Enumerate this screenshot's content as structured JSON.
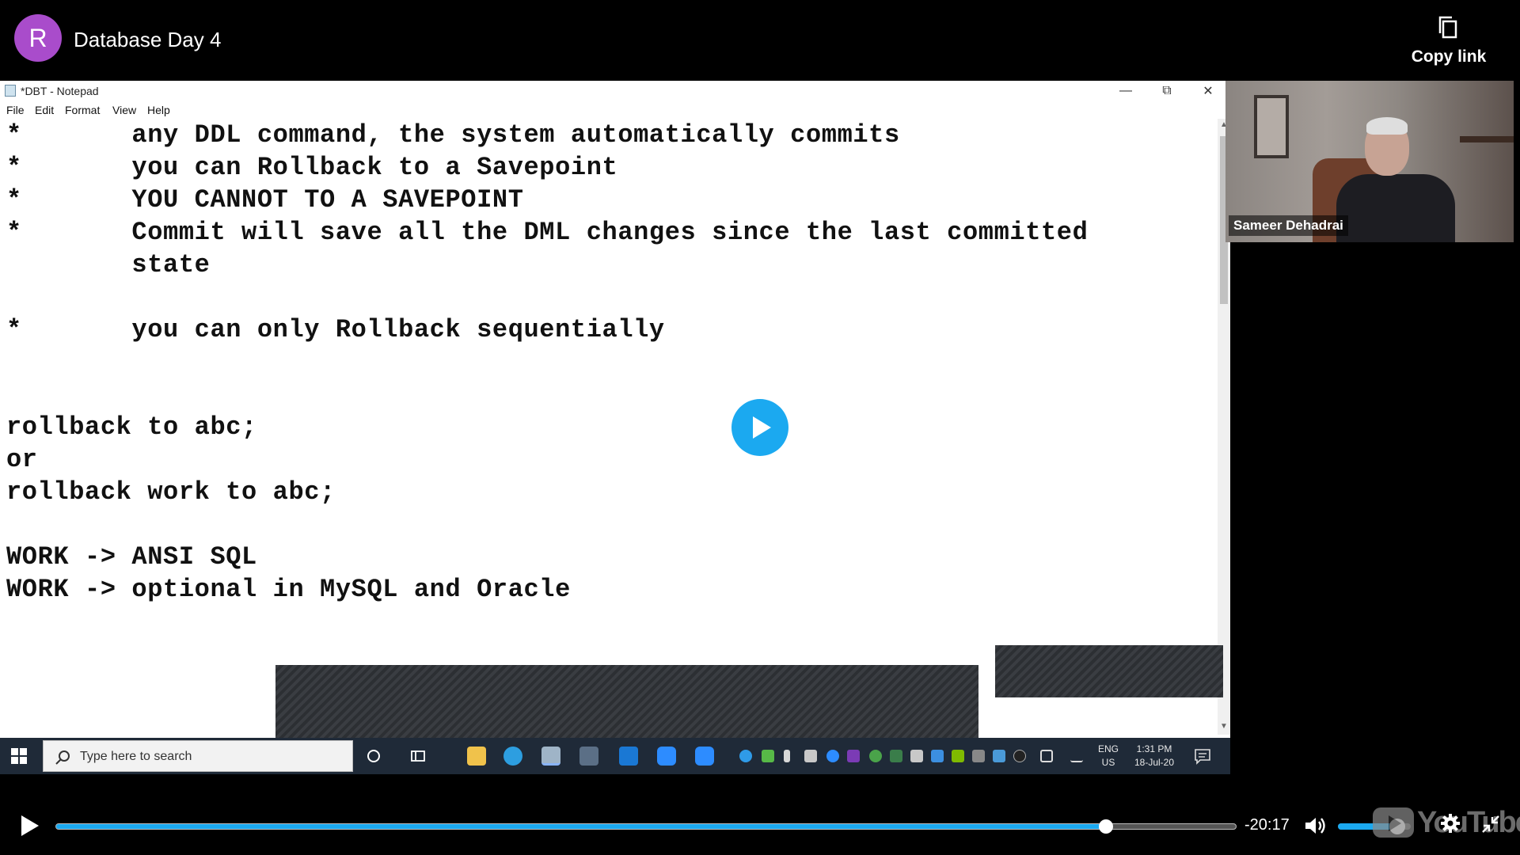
{
  "player": {
    "channel_initial": "R",
    "title": "Database Day 4",
    "copy_link_label": "Copy link",
    "time_remaining": "-20:17",
    "progress_fraction": 0.89,
    "volume_fraction": 0.82,
    "logo_text": "YouTube",
    "accent_color": "#1ba9f0",
    "avatar_color": "#a94ccb"
  },
  "notepad": {
    "title": "*DBT - Notepad",
    "menu": [
      "File",
      "Edit",
      "Format",
      "View",
      "Help"
    ],
    "lines": [
      "*       any DDL command, the system automatically commits",
      "*       you can Rollback to a Savepoint",
      "*       YOU CANNOT TO A SAVEPOINT",
      "*       Commit will save all the DML changes since the last committed",
      "        state",
      "",
      "*       you can only Rollback sequentially",
      "",
      "",
      "rollback to abc;",
      "or",
      "rollback work to abc;",
      "",
      "WORK -> ANSI SQL",
      "WORK -> optional in MySQL and Oracle"
    ]
  },
  "taskbar": {
    "search_placeholder": "Type here to search",
    "lang_top": "ENG",
    "lang_bottom": "US",
    "time": "1:31 PM",
    "date": "18-Jul-20"
  },
  "participant": {
    "name": "Sameer Dehadrai"
  }
}
